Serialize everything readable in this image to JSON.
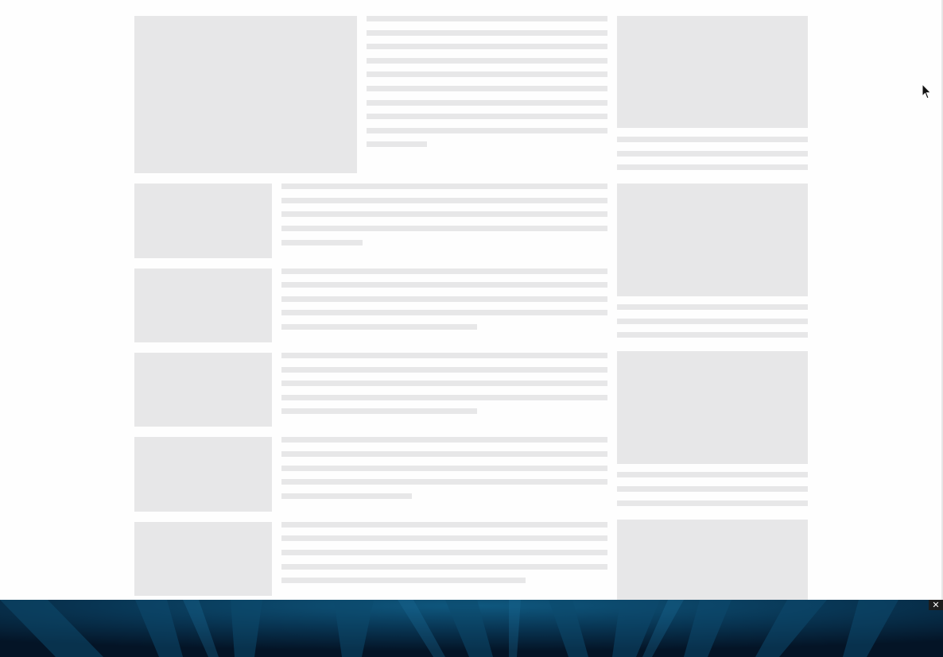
{
  "ad_banner": {
    "close_glyph": "✕",
    "close_icon": "close-icon",
    "background_color": "#061a2e",
    "accent_color": "#0d4a6e"
  },
  "placeholder_color": "#e7e7e8",
  "cursor_icon": "arrow-cursor-icon"
}
